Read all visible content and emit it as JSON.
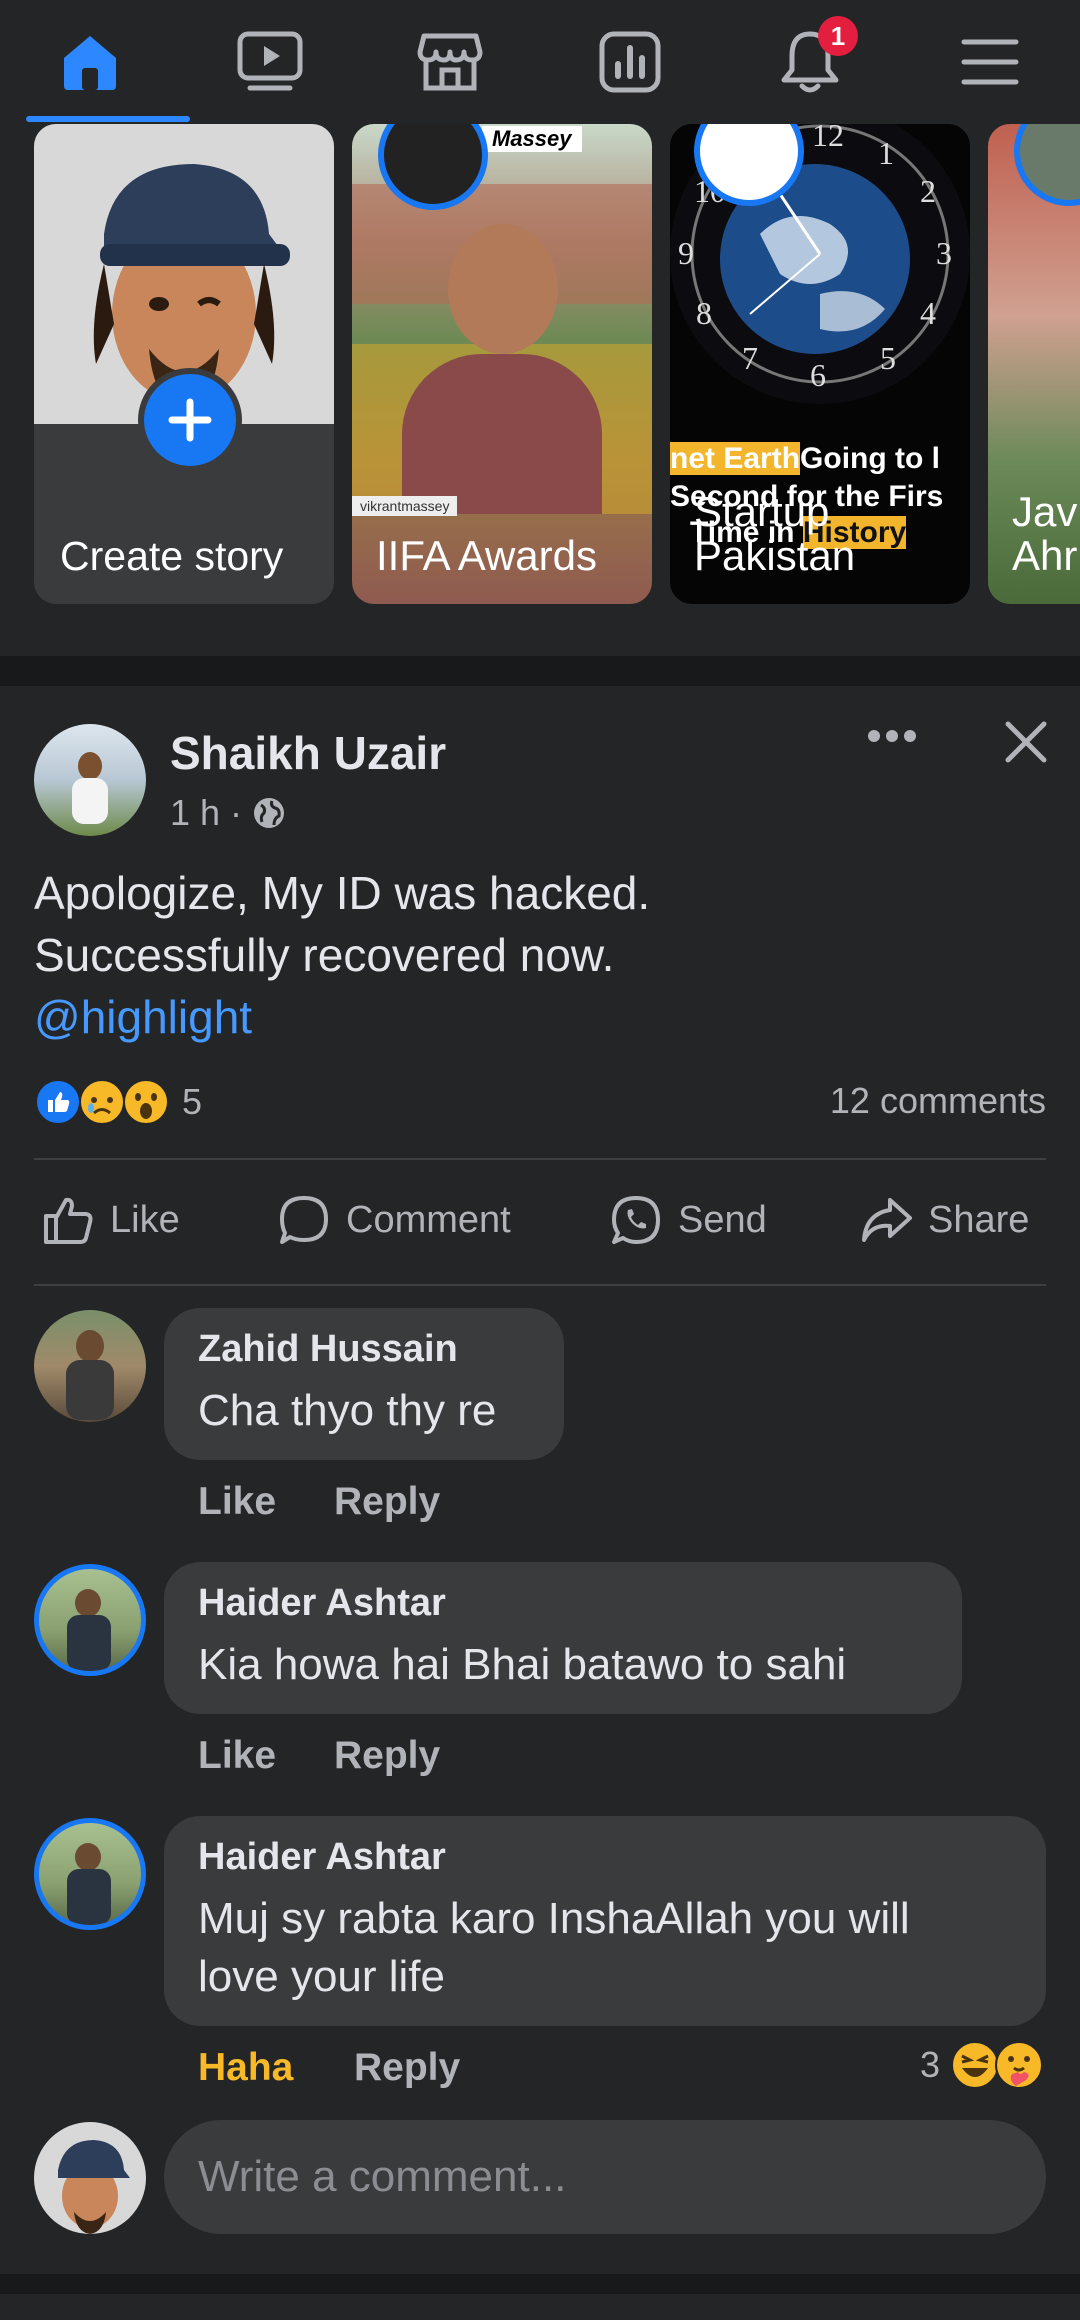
{
  "nav": {
    "items": [
      "home-icon",
      "watch-icon",
      "marketplace-icon",
      "feeds-icon",
      "notifications-icon",
      "menu-icon"
    ],
    "notification_count": "1",
    "accent": "#2d88ff"
  },
  "stories": [
    {
      "label": "Create story"
    },
    {
      "label": "IIFA Awards",
      "overlay_top": "Massey",
      "badge_text": "vikrantmassey"
    },
    {
      "label": "Startup Pakistan",
      "headline_1": "net Earth",
      "headline_2": "Going to l",
      "headline_3": "Second for the Firs",
      "headline_4": "Time in",
      "headline_5": "History"
    },
    {
      "label": "Jav Ahr"
    }
  ],
  "post": {
    "author": "Shaikh Uzair",
    "time": "1 h ·",
    "text_line1": "Apologize, My ID was hacked.",
    "text_line2": "Successfully recovered now.",
    "mention": "@highlight",
    "reaction_count": "5",
    "comments_count": "12 comments",
    "actions": {
      "like": "Like",
      "comment": "Comment",
      "send": "Send",
      "share": "Share"
    }
  },
  "comments": [
    {
      "name": "Zahid Hussain",
      "text": "Cha thyo thy re",
      "like": "Like",
      "reply": "Reply"
    },
    {
      "name": "Haider Ashtar",
      "text": "Kia howa hai Bhai batawo to sahi",
      "like": "Like",
      "reply": "Reply"
    },
    {
      "name": "Haider Ashtar",
      "text_line1": "Muj sy rabta karo InshaAllah you will",
      "text_line2": "love your life",
      "like": "Haha",
      "reply": "Reply",
      "reaction_count": "3"
    }
  ],
  "composer": {
    "placeholder": "Write a comment..."
  },
  "colors": {
    "haha": "#f7b928",
    "link": "#4599ff"
  }
}
